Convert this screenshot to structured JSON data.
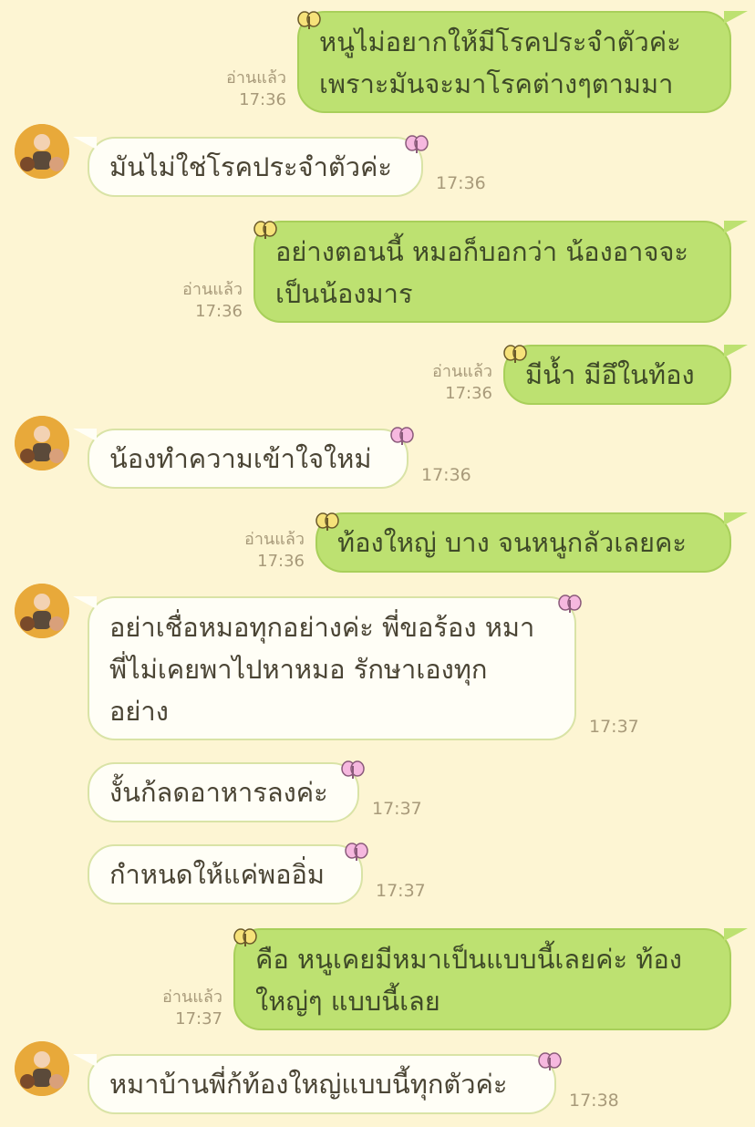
{
  "messages": [
    {
      "dir": "out",
      "lines": [
        "หนูไม่อยากให้มีโรคประจำตัวค่ะ",
        "เพราะมันจะมาโรคต่างๆตามมา"
      ],
      "read": "อ่านแล้ว",
      "time": "17:36"
    },
    {
      "dir": "in",
      "lines": [
        "มันไม่ใช่โรคประจำตัวค่ะ"
      ],
      "time": "17:36",
      "avatar": true
    },
    {
      "dir": "out",
      "lines": [
        "อย่างตอนนี้ หมอก็บอกว่า น้องอาจจะ",
        "เป็นน้องมาร"
      ],
      "read": "อ่านแล้ว",
      "time": "17:36"
    },
    {
      "dir": "out",
      "lines": [
        "มีน้ำ มีอึในท้อง"
      ],
      "read": "อ่านแล้ว",
      "time": "17:36"
    },
    {
      "dir": "in",
      "lines": [
        "น้องทำความเข้าใจใหม่"
      ],
      "time": "17:36",
      "avatar": true
    },
    {
      "dir": "out",
      "lines": [
        "ท้องใหญ่ บาง จนหนูกลัวเลยคะ"
      ],
      "read": "อ่านแล้ว",
      "time": "17:36"
    },
    {
      "dir": "in",
      "lines": [
        "อย่าเชื่อหมอทุกอย่างค่ะ พี่ขอร้อง หมา",
        "พี่ไม่เคยพาไปหาหมอ รักษาเองทุก",
        "อย่าง"
      ],
      "time": "17:37",
      "avatar": true
    },
    {
      "dir": "in",
      "lines": [
        "งั้นก้ลดอาหารลงค่ะ"
      ],
      "time": "17:37"
    },
    {
      "dir": "in",
      "lines": [
        "กำหนดให้แค่พออิ่ม"
      ],
      "time": "17:37"
    },
    {
      "dir": "out",
      "lines": [
        "คือ หนูเคยมีหมาเป็นแบบนี้เลยค่ะ ท้อง",
        "ใหญ่ๆ แบบนี้เลย"
      ],
      "read": "อ่านแล้ว",
      "time": "17:37"
    },
    {
      "dir": "in",
      "lines": [
        "หมาบ้านพี่ก้ท้องใหญ่แบบนี้ทุกตัวค่ะ"
      ],
      "time": "17:38",
      "avatar": true
    }
  ],
  "colors": {
    "background": "#fdf5d3",
    "outgoing_bubble": "#bde171",
    "incoming_bubble": "#fffef6",
    "meta_text": "#a89a7a"
  },
  "icons": {
    "outgoing_decoration": "butterfly-yellow-icon",
    "incoming_decoration": "butterfly-pink-icon",
    "avatar": "user-avatar-icon"
  }
}
